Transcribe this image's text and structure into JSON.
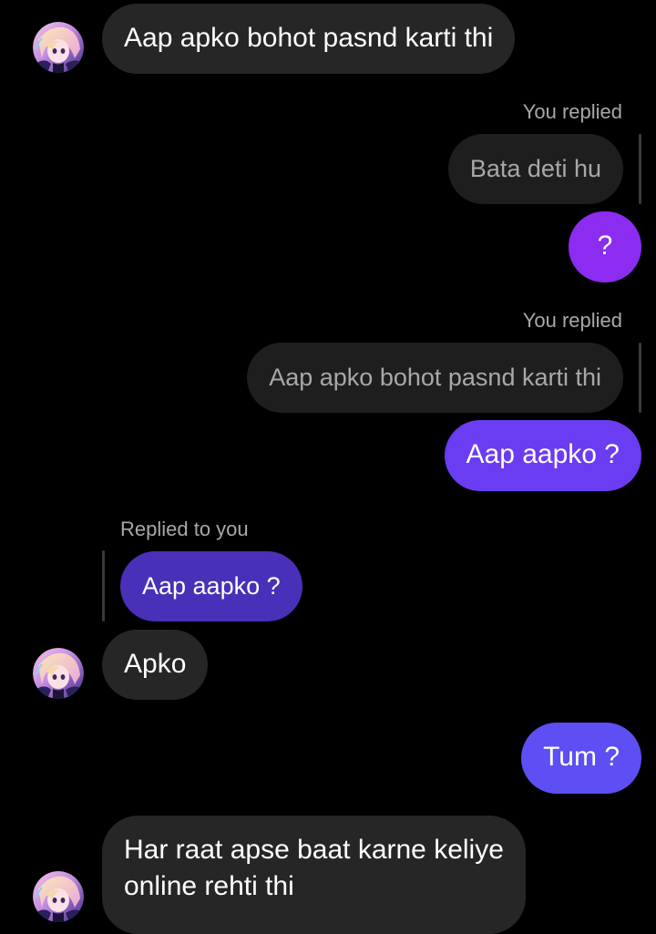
{
  "chat": {
    "colors": {
      "background": "#000000",
      "incoming_bubble": "#262626",
      "reply_quote_bubble": "#1e1e1e",
      "outgoing_purple": "#8b2cf0",
      "outgoing_violet": "#6a3cf2",
      "outgoing_indigo": "#5d4ff3",
      "quoted_outgoing": "#4a2fb8",
      "secondary_text": "#a8a8a8"
    },
    "messages": [
      {
        "id": "m1",
        "direction": "incoming",
        "text": "Aap apko bohot pasnd karti thi",
        "avatar": "anime-girl-avatar"
      },
      {
        "id": "m2",
        "direction": "outgoing",
        "reply_label": "You replied",
        "quoted_text": "Bata deti hu",
        "text": "?"
      },
      {
        "id": "m3",
        "direction": "outgoing",
        "reply_label": "You replied",
        "quoted_text": "Aap apko bohot pasnd karti thi",
        "text": "Aap aapko ?"
      },
      {
        "id": "m4",
        "direction": "incoming",
        "reply_label": "Replied to you",
        "quoted_text": "Aap aapko ?",
        "text": "Apko",
        "avatar": "anime-girl-avatar"
      },
      {
        "id": "m5",
        "direction": "outgoing",
        "text": "Tum ?"
      },
      {
        "id": "m6",
        "direction": "incoming",
        "text_line1": "Har raat apse baat karne keliye",
        "text_line2": "online rehti thi",
        "avatar": "anime-girl-avatar"
      }
    ]
  }
}
